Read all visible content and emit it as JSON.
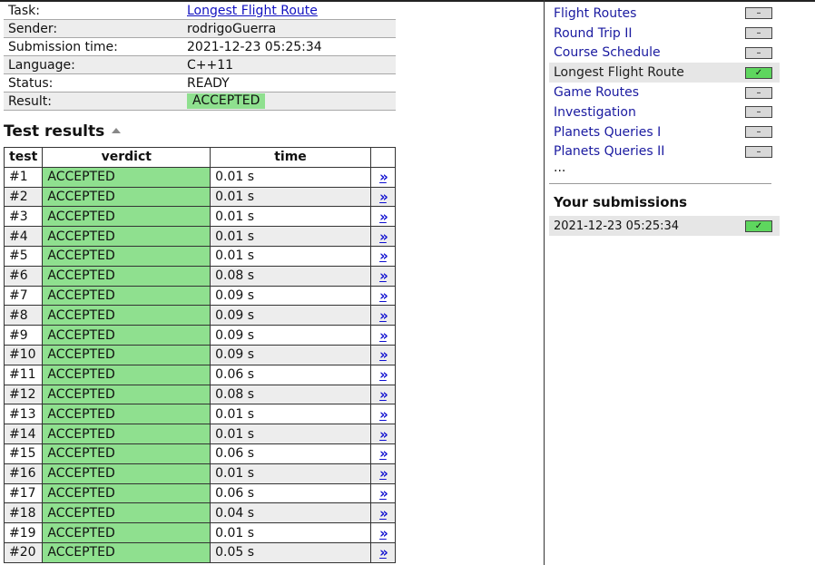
{
  "summary": [
    {
      "key": "Task:",
      "value": "Longest Flight Route",
      "type": "link"
    },
    {
      "key": "Sender:",
      "value": "rodrigoGuerra",
      "type": "text"
    },
    {
      "key": "Submission time:",
      "value": "2021-12-23 05:25:34",
      "type": "text"
    },
    {
      "key": "Language:",
      "value": "C++11",
      "type": "text"
    },
    {
      "key": "Status:",
      "value": "READY",
      "type": "text"
    },
    {
      "key": "Result:",
      "value": "ACCEPTED",
      "type": "badge"
    }
  ],
  "results_title": "Test results",
  "results_headers": [
    "test",
    "verdict",
    "time"
  ],
  "detail_glyph": "»",
  "results": [
    {
      "test": "#1",
      "verdict": "ACCEPTED",
      "time": "0.01 s"
    },
    {
      "test": "#2",
      "verdict": "ACCEPTED",
      "time": "0.01 s"
    },
    {
      "test": "#3",
      "verdict": "ACCEPTED",
      "time": "0.01 s"
    },
    {
      "test": "#4",
      "verdict": "ACCEPTED",
      "time": "0.01 s"
    },
    {
      "test": "#5",
      "verdict": "ACCEPTED",
      "time": "0.01 s"
    },
    {
      "test": "#6",
      "verdict": "ACCEPTED",
      "time": "0.08 s"
    },
    {
      "test": "#7",
      "verdict": "ACCEPTED",
      "time": "0.09 s"
    },
    {
      "test": "#8",
      "verdict": "ACCEPTED",
      "time": "0.09 s"
    },
    {
      "test": "#9",
      "verdict": "ACCEPTED",
      "time": "0.09 s"
    },
    {
      "test": "#10",
      "verdict": "ACCEPTED",
      "time": "0.09 s"
    },
    {
      "test": "#11",
      "verdict": "ACCEPTED",
      "time": "0.06 s"
    },
    {
      "test": "#12",
      "verdict": "ACCEPTED",
      "time": "0.08 s"
    },
    {
      "test": "#13",
      "verdict": "ACCEPTED",
      "time": "0.01 s"
    },
    {
      "test": "#14",
      "verdict": "ACCEPTED",
      "time": "0.01 s"
    },
    {
      "test": "#15",
      "verdict": "ACCEPTED",
      "time": "0.06 s"
    },
    {
      "test": "#16",
      "verdict": "ACCEPTED",
      "time": "0.01 s"
    },
    {
      "test": "#17",
      "verdict": "ACCEPTED",
      "time": "0.06 s"
    },
    {
      "test": "#18",
      "verdict": "ACCEPTED",
      "time": "0.04 s"
    },
    {
      "test": "#19",
      "verdict": "ACCEPTED",
      "time": "0.01 s"
    },
    {
      "test": "#20",
      "verdict": "ACCEPTED",
      "time": "0.05 s"
    }
  ],
  "sidebar": {
    "tasks": [
      {
        "name": "Flight Routes",
        "status": "none",
        "current": false
      },
      {
        "name": "Round Trip II",
        "status": "none",
        "current": false
      },
      {
        "name": "Course Schedule",
        "status": "none",
        "current": false
      },
      {
        "name": "Longest Flight Route",
        "status": "accepted",
        "current": true
      },
      {
        "name": "Game Routes",
        "status": "none",
        "current": false
      },
      {
        "name": "Investigation",
        "status": "none",
        "current": false
      },
      {
        "name": "Planets Queries I",
        "status": "none",
        "current": false
      },
      {
        "name": "Planets Queries II",
        "status": "none",
        "current": false
      }
    ],
    "more": "...",
    "submissions_title": "Your submissions",
    "submissions": [
      {
        "time": "2021-12-23 05:25:34",
        "status": "accepted"
      }
    ],
    "status_glyphs": {
      "none": "–",
      "accepted": "✓"
    }
  },
  "colors": {
    "accepted": "#8fe08f",
    "status_ok": "#5ed65e",
    "link": "#1010c0"
  }
}
